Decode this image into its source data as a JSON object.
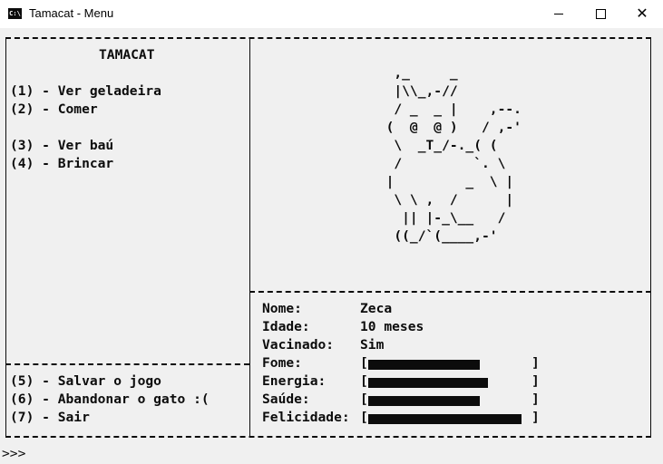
{
  "window": {
    "title": "Tamacat - Menu",
    "icon": "console-icon"
  },
  "menu": {
    "heading": "TAMACAT",
    "items": [
      "(1) - Ver geladeira",
      "(2) - Comer",
      "(3) - Ver baú",
      "(4) - Brincar"
    ],
    "footer_items": [
      "(5) - Salvar o jogo",
      "(6) - Abandonar o gato :(",
      "(7) - Sair"
    ]
  },
  "cat_art": "   ,_     _\n   |\\\\_,-//\n   / _  _ |    ,--.\n  (  @  @ )   / ,-'\n   \\  _T_/-._( (\n   /         `. \\\n  |         _  \\ |\n   \\ \\ ,  /      |\n    || |-_\\__   /\n   ((_/`(____,-'",
  "stats": {
    "nome_label": "Nome:",
    "nome_value": "Zeca",
    "idade_label": "Idade:",
    "idade_value": "10 meses",
    "vacinado_label": "Vacinado:",
    "vacinado_value": "Sim",
    "fome_label": "Fome:",
    "fome_level": 0.7,
    "energia_label": "Energia:",
    "energia_level": 0.75,
    "saude_label": "Saúde:",
    "saude_level": 0.7,
    "felicidade_label": "Felicidade:",
    "felicidade_level": 0.96
  },
  "bracket_open": "[",
  "bracket_close": "]",
  "prompt": ">>>"
}
